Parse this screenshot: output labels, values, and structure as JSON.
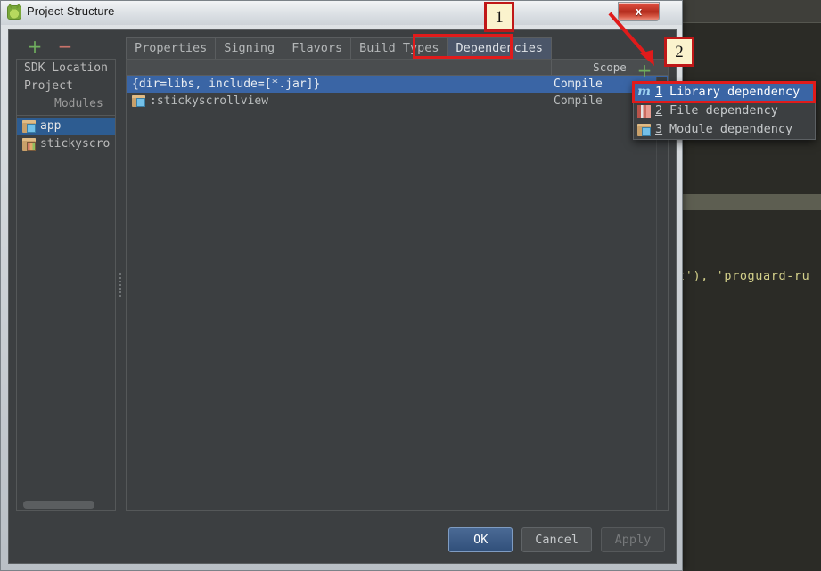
{
  "window": {
    "title": "Project Structure",
    "app_icon": "android-studio-icon",
    "close_label": "x"
  },
  "background_ide": {
    "code_fragment": "t'), 'proguard-ru"
  },
  "sidebar": {
    "toolbar": {
      "add_label": "+",
      "remove_label": "−"
    },
    "items": [
      {
        "label": "SDK Location",
        "icon": null,
        "selected": false,
        "group": false
      },
      {
        "label": "Project",
        "icon": null,
        "selected": false,
        "group": false
      },
      {
        "label": "Modules",
        "icon": null,
        "selected": false,
        "group": true
      },
      {
        "label": "app",
        "icon": "folder-icon",
        "selected": true,
        "group": false
      },
      {
        "label": "stickyscro",
        "icon": "folder-bars-icon",
        "selected": false,
        "group": false
      }
    ]
  },
  "tabs": [
    {
      "label": "Properties",
      "active": false
    },
    {
      "label": "Signing",
      "active": false
    },
    {
      "label": "Flavors",
      "active": false
    },
    {
      "label": "Build Types",
      "active": false
    },
    {
      "label": "Dependencies",
      "active": true
    }
  ],
  "table": {
    "columns": [
      "",
      "Scope"
    ],
    "rows": [
      {
        "name": "{dir=libs, include=[*.jar]}",
        "scope": "Compile",
        "icon": null,
        "selected": true
      },
      {
        "name": ":stickyscrollview",
        "scope": "Compile",
        "icon": "folder-icon",
        "selected": false
      }
    ]
  },
  "popup_menu": {
    "add_label": "+",
    "items": [
      {
        "mnemonic": "1",
        "label": "Library dependency",
        "icon": "maven-m-icon",
        "selected": true
      },
      {
        "mnemonic": "2",
        "label": "File dependency",
        "icon": "bars-icon",
        "selected": false
      },
      {
        "mnemonic": "3",
        "label": "Module dependency",
        "icon": "folder-icon",
        "selected": false
      }
    ]
  },
  "buttons": {
    "ok": "OK",
    "cancel": "Cancel",
    "apply": "Apply"
  },
  "annotations": {
    "marker_1": "1",
    "marker_2": "2",
    "highlight_color": "#e01b1b",
    "marker_fill": "#fbf3cd"
  }
}
